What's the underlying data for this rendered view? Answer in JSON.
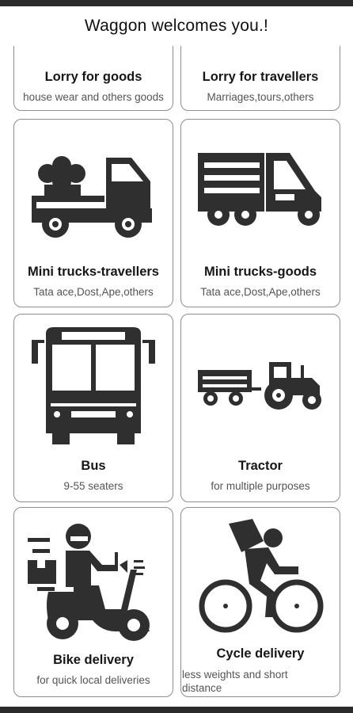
{
  "header": {
    "title": "Waggon welcomes you.!"
  },
  "cards": [
    {
      "title": "Lorry for goods",
      "subtitle": "house wear and others goods",
      "icon": "lorry-goods-icon"
    },
    {
      "title": "Lorry for travellers",
      "subtitle": "Marriages,tours,others",
      "icon": "lorry-travellers-icon"
    },
    {
      "title": "Mini trucks-travellers",
      "subtitle": "Tata ace,Dost,Ape,others",
      "icon": "mini-truck-travellers-icon"
    },
    {
      "title": "Mini trucks-goods",
      "subtitle": "Tata ace,Dost,Ape,others",
      "icon": "mini-truck-goods-icon"
    },
    {
      "title": "Bus",
      "subtitle": "9-55 seaters",
      "icon": "bus-icon"
    },
    {
      "title": "Tractor",
      "subtitle": "for multiple purposes",
      "icon": "tractor-icon"
    },
    {
      "title": "Bike delivery",
      "subtitle": "for quick local deliveries",
      "icon": "bike-delivery-icon"
    },
    {
      "title": "Cycle delivery",
      "subtitle": "less weights and short distance",
      "icon": "cycle-delivery-icon"
    }
  ],
  "colors": {
    "icon": "#2f2f2f",
    "border": "#8e8e8e",
    "subtitle": "#555555"
  }
}
